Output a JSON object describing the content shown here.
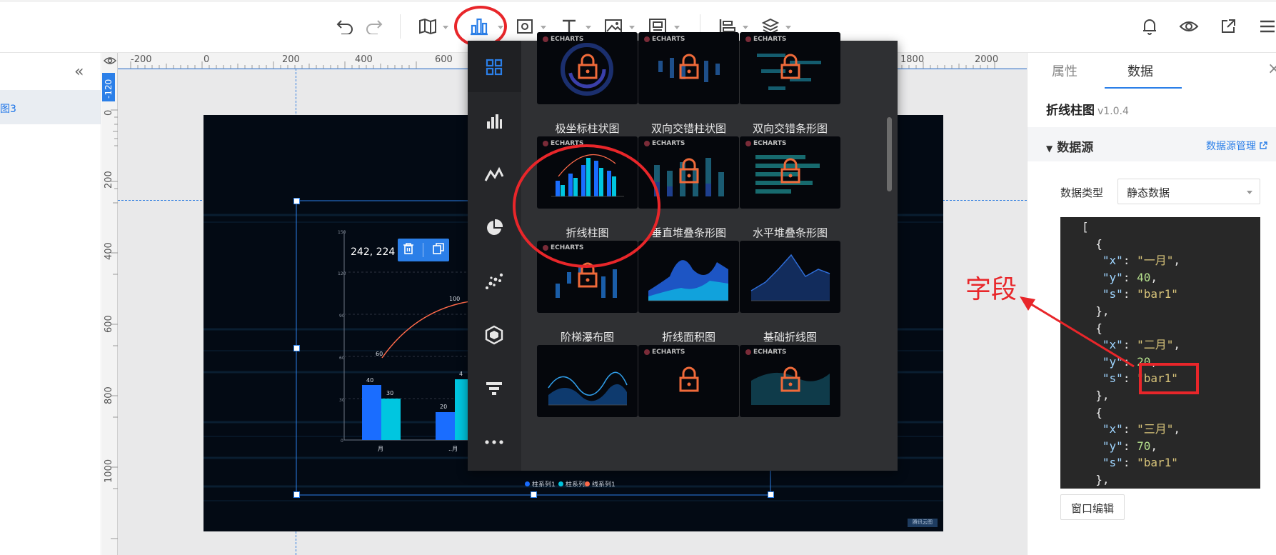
{
  "toolbar": {
    "icons": [
      "undo-icon",
      "redo-icon",
      "map-icon",
      "bar-chart-icon",
      "frame-icon",
      "text-icon",
      "image-icon",
      "media-icon",
      "align-icon",
      "layers-icon",
      "bell-icon",
      "eye-icon",
      "share-icon",
      "menu-icon"
    ],
    "active": "bar-chart-icon",
    "accent": "#2b7fe8"
  },
  "left_panel": {
    "collapse_icon": "double-chevron-left-icon",
    "item_label": "图3"
  },
  "ruler": {
    "h_labels": [
      "-200",
      "0",
      "200",
      "400",
      "600",
      "1800",
      "2000"
    ],
    "v_labels": [
      "0",
      "200",
      "400",
      "600",
      "800",
      "1000"
    ],
    "badge": "-120"
  },
  "canvas": {
    "position_label": "242, 224",
    "legend": [
      {
        "name": "柱系列1",
        "color": "#1a6dff"
      },
      {
        "name": "柱系列2",
        "color": "#00c6e0"
      },
      {
        "name": "线系列1",
        "color": "#ff6a4a"
      }
    ],
    "watermark": "腾讯云图"
  },
  "dropdown": {
    "categories": [
      "grid-icon",
      "bar-icon",
      "line-icon",
      "pie-icon",
      "scatter-icon",
      "hexagon-icon",
      "funnel-icon",
      "more-icon"
    ],
    "echarts_tag": "ECHARTS",
    "charts": [
      {
        "label": "极坐标柱状图",
        "locked": true
      },
      {
        "label": "双向交错柱状图",
        "locked": true
      },
      {
        "label": "双向交错条形图",
        "locked": true
      },
      {
        "label": "折线柱图",
        "locked": false
      },
      {
        "label": "垂直堆叠条形图",
        "locked": true
      },
      {
        "label": "水平堆叠条形图",
        "locked": true
      },
      {
        "label": "阶梯瀑布图",
        "locked": true
      },
      {
        "label": "折线面积图",
        "locked": false
      },
      {
        "label": "基础折线图",
        "locked": false
      },
      {
        "label": "",
        "locked": false
      },
      {
        "label": "",
        "locked": true
      },
      {
        "label": "",
        "locked": true
      }
    ]
  },
  "right_panel": {
    "tabs": [
      "属性",
      "数据"
    ],
    "active_tab": "数据",
    "title": "折线柱图",
    "version": "v1.0.4",
    "section_title": "数据源",
    "datasource_link": "数据源管理",
    "data_type_label": "数据类型",
    "data_type_value": "静态数据",
    "code_lines": [
      {
        "t": "["
      },
      {
        "t": "  {"
      },
      {
        "k": "x",
        "v": "\"一月\"",
        "vt": "s"
      },
      {
        "k": "y",
        "v": "40",
        "vt": "n"
      },
      {
        "k": "s",
        "v": "\"bar1\"",
        "vt": "s",
        "last": true
      },
      {
        "t": "  },"
      },
      {
        "t": "  {"
      },
      {
        "k": "x",
        "v": "\"二月\"",
        "vt": "s"
      },
      {
        "k": "y",
        "v": "20",
        "vt": "n"
      },
      {
        "k": "s",
        "v": "\"bar1\"",
        "vt": "s",
        "last": true
      },
      {
        "t": "  },"
      },
      {
        "t": "  {"
      },
      {
        "k": "x",
        "v": "\"三月\"",
        "vt": "s"
      },
      {
        "k": "y",
        "v": "70",
        "vt": "n"
      },
      {
        "k": "s",
        "v": "\"bar1\"",
        "vt": "s",
        "last": true
      },
      {
        "t": "  },"
      }
    ],
    "window_edit_button": "窗口编辑"
  },
  "annotation": {
    "text": "字段",
    "color": "#e8262a"
  }
}
